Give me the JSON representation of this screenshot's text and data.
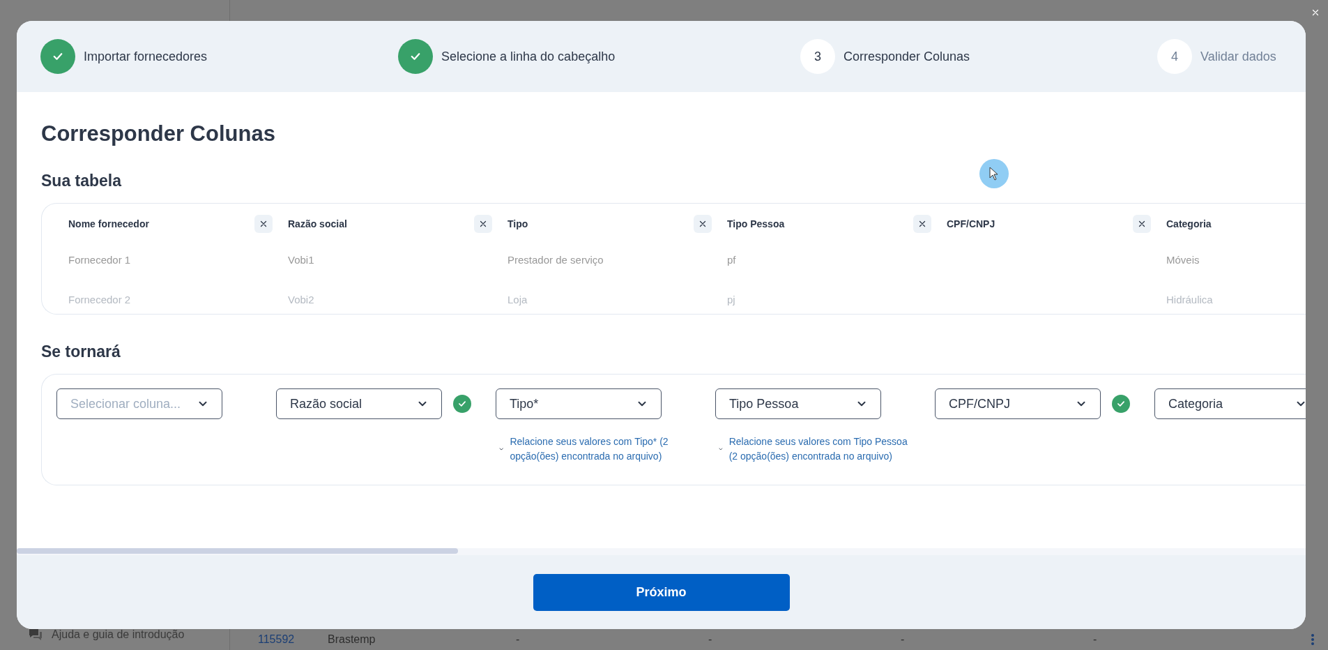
{
  "background": {
    "sidebar_item": "Ajuda e guia de introdução",
    "row": [
      "115592",
      "Brastemp",
      "-",
      "-",
      "-",
      "-"
    ]
  },
  "steps": [
    {
      "label": "Importar fornecedores",
      "completed": true,
      "upcoming": false
    },
    {
      "label": "Selecione a linha do cabeçalho",
      "completed": true,
      "upcoming": false
    },
    {
      "number": "3",
      "label": "Corresponder Colunas",
      "completed": false,
      "upcoming": false
    },
    {
      "number": "4",
      "label": "Validar dados",
      "completed": false,
      "upcoming": true
    }
  ],
  "title": "Corresponder Colunas",
  "source": {
    "heading": "Sua tabela",
    "columns": [
      {
        "header": "Nome fornecedor",
        "values": [
          "Fornecedor 1",
          "Fornecedor 2"
        ]
      },
      {
        "header": "Razão social",
        "values": [
          "Vobi1",
          "Vobi2"
        ]
      },
      {
        "header": "Tipo",
        "values": [
          "Prestador de serviço",
          "Loja"
        ]
      },
      {
        "header": "Tipo Pessoa",
        "values": [
          "pf",
          "pj"
        ]
      },
      {
        "header": "CPF/CNPJ"
      },
      {
        "header": "Categoria",
        "values": [
          "Móveis",
          "Hidráulica"
        ]
      }
    ]
  },
  "target": {
    "heading": "Se tornará",
    "fields": [
      {
        "placeholder": "Selecionar coluna...",
        "matched": false
      },
      {
        "value": "Razão social",
        "matched": true
      },
      {
        "value": "Tipo*",
        "matched": false,
        "hint": "Relacione seus valores com Tipo* (2 opção(ões) encontrada no arquivo)"
      },
      {
        "value": "Tipo Pessoa",
        "matched": false,
        "hint": "Relacione seus valores com Tipo Pessoa (2 opção(ões) encontrada no arquivo)"
      },
      {
        "value": "CPF/CNPJ",
        "matched": true
      },
      {
        "value": "Categoria"
      }
    ]
  },
  "next_button": "Próximo"
}
